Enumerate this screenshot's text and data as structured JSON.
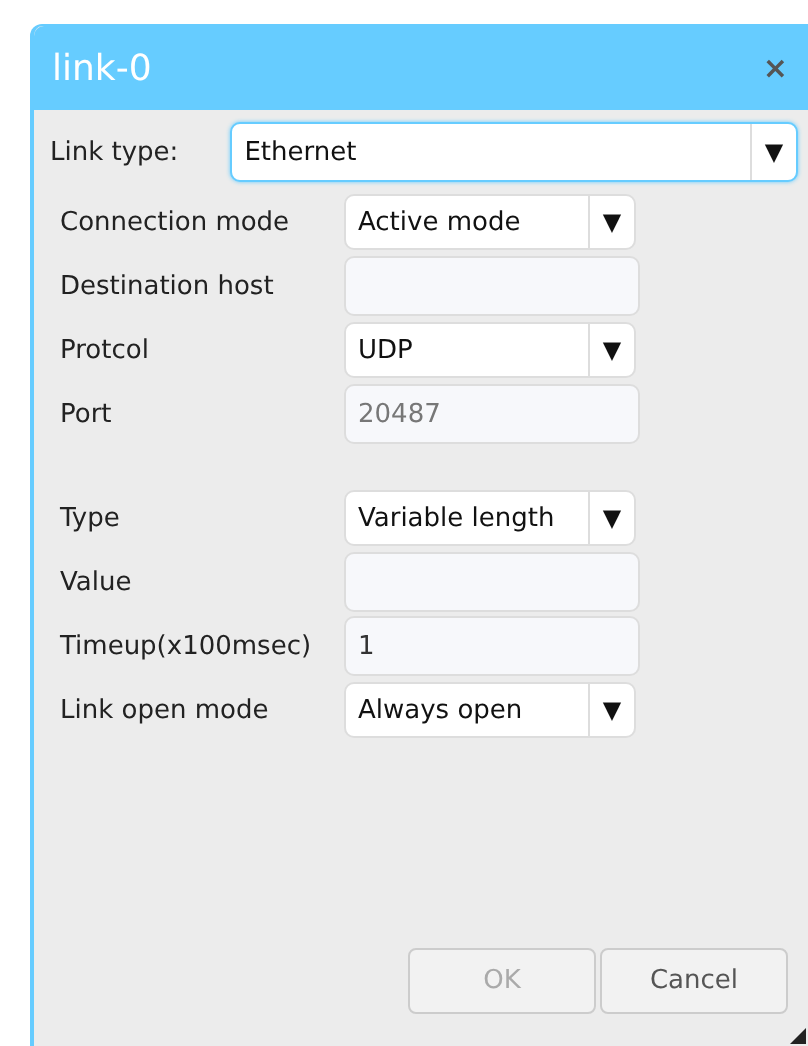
{
  "dialog": {
    "title": "link-0",
    "close": "×"
  },
  "link_type": {
    "label": "Link type:",
    "value": "Ethernet",
    "arrow": "▼"
  },
  "groups": [
    [
      {
        "label": "Connection mode",
        "kind": "select",
        "value": "Active mode",
        "arrow": "▼"
      },
      {
        "label": "Destination host",
        "kind": "input"
      },
      {
        "label": "Protcol",
        "kind": "select",
        "value": "UDP",
        "arrow": "▼"
      },
      {
        "label": "Port",
        "kind": "input",
        "value": "20487",
        "disabled": true
      }
    ],
    [
      {
        "label": "Type",
        "kind": "select",
        "value": "Variable length",
        "arrow": "▼"
      },
      {
        "label": "Value",
        "kind": "input"
      },
      {
        "label": "Timeup(x100msec)",
        "kind": "input",
        "value": "1",
        "disabled": false
      },
      {
        "label": "Link open mode",
        "kind": "select",
        "value": "Always open",
        "arrow": "▼"
      }
    ]
  ],
  "buttons": [
    {
      "label": "OK",
      "disabled": true
    },
    {
      "label": "Cancel",
      "disabled": false
    }
  ]
}
